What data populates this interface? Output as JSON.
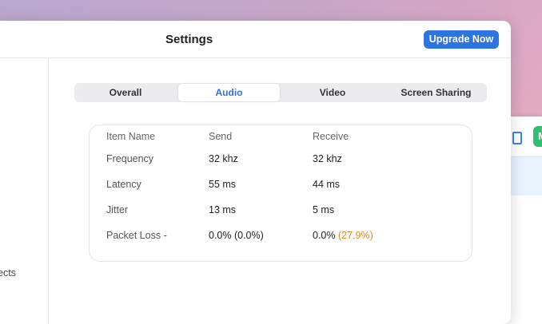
{
  "window": {
    "title": "Settings",
    "upgrade_label": "Upgrade Now"
  },
  "sidebar": {
    "visible_item_fragment": "ects"
  },
  "tabs": [
    {
      "label": "Overall",
      "active": false
    },
    {
      "label": "Audio",
      "active": true
    },
    {
      "label": "Video",
      "active": false
    },
    {
      "label": "Screen Sharing",
      "active": false
    }
  ],
  "stats_table": {
    "headers": [
      "Item Name",
      "Send",
      "Receive"
    ],
    "rows": [
      {
        "name": "Frequency",
        "send": "32 khz",
        "receive": "32 khz",
        "receive_extra": ""
      },
      {
        "name": "Latency",
        "send": "55 ms",
        "receive": "44 ms",
        "receive_extra": ""
      },
      {
        "name": "Jitter",
        "send": "13 ms",
        "receive": "5 ms",
        "receive_extra": ""
      },
      {
        "name": "Packet Loss -",
        "send": "0.0% (0.0%)",
        "receive": "0.0%",
        "receive_extra": "(27.9%)"
      }
    ]
  },
  "background": {
    "avatar_letter": "M"
  },
  "colors": {
    "accent": "#2d74e0",
    "warning": "#e08a1e",
    "avatar": "#2fbf71"
  }
}
